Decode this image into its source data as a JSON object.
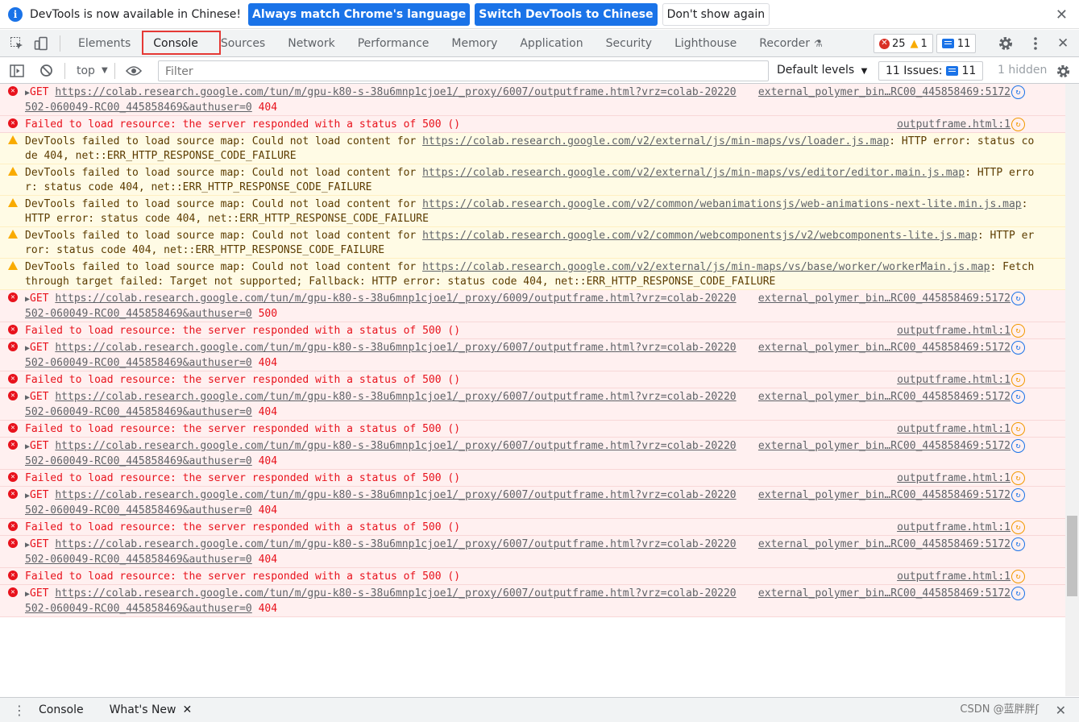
{
  "infobar": {
    "message": "DevTools is now available in Chinese!",
    "btn_match": "Always match Chrome's language",
    "btn_switch": "Switch DevTools to Chinese",
    "btn_dismiss": "Don't show again",
    "close": "✕"
  },
  "tabs": [
    "Elements",
    "Console",
    "Sources",
    "Network",
    "Performance",
    "Memory",
    "Application",
    "Security",
    "Lighthouse",
    "Recorder"
  ],
  "active_tab": "Console",
  "counters": {
    "errors": "25",
    "warnings": "1",
    "messages": "11"
  },
  "toolbar": {
    "context": "top",
    "filter_placeholder": "Filter",
    "levels": "Default levels",
    "issues_count": "11 Issues:",
    "issues_badge": "11",
    "hidden": "1 hidden"
  },
  "rows": [
    {
      "type": "err",
      "expand": true,
      "pre": "GET ",
      "link": "https://colab.research.google.com/tun/m/gpu-k80-s-38u6mnp1cjoe1/_proxy/6007/outputframe.html?vrz=colab-20220502-060049-RC00_445858469&authuser=0",
      "post": " 404",
      "src": "external_polymer_bin…RC00_445858469:5172",
      "fn": "blue"
    },
    {
      "type": "err",
      "expand": false,
      "pre": "Failed to load resource: the server responded with a status of 500 ()",
      "link": "",
      "post": "",
      "src": "outputframe.html:1",
      "fn": "orange"
    },
    {
      "type": "warn",
      "expand": false,
      "pre": "DevTools failed to load source map: Could not load content for ",
      "link": "https://colab.research.google.com/v2/external/js/min-maps/vs/loader.js.map",
      "post": ": HTTP error: status code 404, net::ERR_HTTP_RESPONSE_CODE_FAILURE",
      "src": "",
      "fn": ""
    },
    {
      "type": "warn",
      "expand": false,
      "pre": "DevTools failed to load source map: Could not load content for ",
      "link": "https://colab.research.google.com/v2/external/js/min-maps/vs/editor/editor.main.js.map",
      "post": ": HTTP error: status code 404, net::ERR_HTTP_RESPONSE_CODE_FAILURE",
      "src": "",
      "fn": ""
    },
    {
      "type": "warn",
      "expand": false,
      "pre": "DevTools failed to load source map: Could not load content for ",
      "link": "https://colab.research.google.com/v2/common/webanimationsjs/web-animations-next-lite.min.js.map",
      "post": ": HTTP error: status code 404, net::ERR_HTTP_RESPONSE_CODE_FAILURE",
      "src": "",
      "fn": ""
    },
    {
      "type": "warn",
      "expand": false,
      "pre": "DevTools failed to load source map: Could not load content for ",
      "link": "https://colab.research.google.com/v2/common/webcomponentsjs/v2/webcomponents-lite.js.map",
      "post": ": HTTP error: status code 404, net::ERR_HTTP_RESPONSE_CODE_FAILURE",
      "src": "",
      "fn": ""
    },
    {
      "type": "warn",
      "expand": false,
      "pre": "DevTools failed to load source map: Could not load content for ",
      "link": "https://colab.research.google.com/v2/external/js/min-maps/vs/base/worker/workerMain.js.map",
      "post": ": Fetch through target failed: Target not supported; Fallback: HTTP error: status code 404, net::ERR_HTTP_RESPONSE_CODE_FAILURE",
      "src": "",
      "fn": ""
    },
    {
      "type": "err",
      "expand": true,
      "pre": "GET ",
      "link": "https://colab.research.google.com/tun/m/gpu-k80-s-38u6mnp1cjoe1/_proxy/6009/outputframe.html?vrz=colab-20220502-060049-RC00_445858469&authuser=0",
      "post": " 500",
      "src": "external_polymer_bin…RC00_445858469:5172",
      "fn": "blue"
    },
    {
      "type": "err",
      "expand": false,
      "pre": "Failed to load resource: the server responded with a status of 500 ()",
      "link": "",
      "post": "",
      "src": "outputframe.html:1",
      "fn": "orange"
    },
    {
      "type": "err",
      "expand": true,
      "pre": "GET ",
      "link": "https://colab.research.google.com/tun/m/gpu-k80-s-38u6mnp1cjoe1/_proxy/6007/outputframe.html?vrz=colab-20220502-060049-RC00_445858469&authuser=0",
      "post": " 404",
      "src": "external_polymer_bin…RC00_445858469:5172",
      "fn": "blue"
    },
    {
      "type": "err",
      "expand": false,
      "pre": "Failed to load resource: the server responded with a status of 500 ()",
      "link": "",
      "post": "",
      "src": "outputframe.html:1",
      "fn": "orange"
    },
    {
      "type": "err",
      "expand": true,
      "pre": "GET ",
      "link": "https://colab.research.google.com/tun/m/gpu-k80-s-38u6mnp1cjoe1/_proxy/6007/outputframe.html?vrz=colab-20220502-060049-RC00_445858469&authuser=0",
      "post": " 404",
      "src": "external_polymer_bin…RC00_445858469:5172",
      "fn": "blue"
    },
    {
      "type": "err",
      "expand": false,
      "pre": "Failed to load resource: the server responded with a status of 500 ()",
      "link": "",
      "post": "",
      "src": "outputframe.html:1",
      "fn": "orange"
    },
    {
      "type": "err",
      "expand": true,
      "pre": "GET ",
      "link": "https://colab.research.google.com/tun/m/gpu-k80-s-38u6mnp1cjoe1/_proxy/6007/outputframe.html?vrz=colab-20220502-060049-RC00_445858469&authuser=0",
      "post": " 404",
      "src": "external_polymer_bin…RC00_445858469:5172",
      "fn": "blue"
    },
    {
      "type": "err",
      "expand": false,
      "pre": "Failed to load resource: the server responded with a status of 500 ()",
      "link": "",
      "post": "",
      "src": "outputframe.html:1",
      "fn": "orange"
    },
    {
      "type": "err",
      "expand": true,
      "pre": "GET ",
      "link": "https://colab.research.google.com/tun/m/gpu-k80-s-38u6mnp1cjoe1/_proxy/6007/outputframe.html?vrz=colab-20220502-060049-RC00_445858469&authuser=0",
      "post": " 404",
      "src": "external_polymer_bin…RC00_445858469:5172",
      "fn": "blue"
    },
    {
      "type": "err",
      "expand": false,
      "pre": "Failed to load resource: the server responded with a status of 500 ()",
      "link": "",
      "post": "",
      "src": "outputframe.html:1",
      "fn": "orange"
    },
    {
      "type": "err",
      "expand": true,
      "pre": "GET ",
      "link": "https://colab.research.google.com/tun/m/gpu-k80-s-38u6mnp1cjoe1/_proxy/6007/outputframe.html?vrz=colab-20220502-060049-RC00_445858469&authuser=0",
      "post": " 404",
      "src": "external_polymer_bin…RC00_445858469:5172",
      "fn": "blue"
    },
    {
      "type": "err",
      "expand": false,
      "pre": "Failed to load resource: the server responded with a status of 500 ()",
      "link": "",
      "post": "",
      "src": "outputframe.html:1",
      "fn": "orange"
    },
    {
      "type": "err",
      "expand": true,
      "pre": "GET ",
      "link": "https://colab.research.google.com/tun/m/gpu-k80-s-38u6mnp1cjoe1/_proxy/6007/outputframe.html?vrz=colab-20220502-060049-RC00_445858469&authuser=0",
      "post": " 404",
      "src": "external_polymer_bin…RC00_445858469:5172",
      "fn": "blue"
    }
  ],
  "drawer": {
    "tab_console": "Console",
    "tab_whatsnew": "What's New",
    "close": "✕"
  },
  "watermark": "CSDN @蓝胖胖ʃ",
  "colors": {
    "accent": "#1a73e8",
    "error": "#e8121c",
    "warning": "#f9ab00",
    "highlight": "#e53935"
  }
}
